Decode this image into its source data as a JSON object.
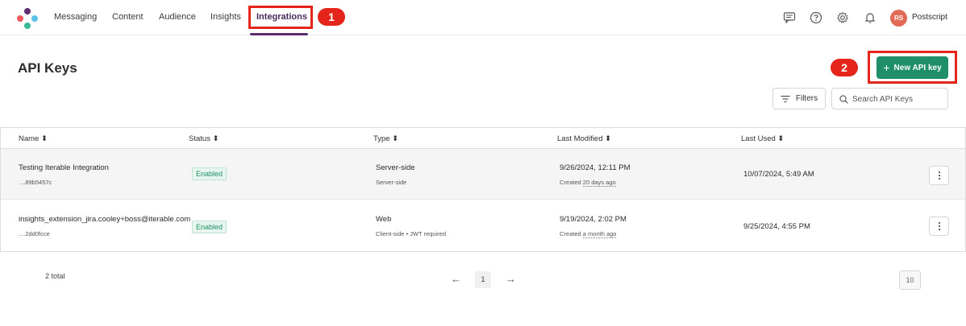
{
  "nav": {
    "items": [
      "Messaging",
      "Content",
      "Audience",
      "Insights",
      "Integrations"
    ],
    "active": "Integrations"
  },
  "account": {
    "initials": "RS",
    "name": "Postscript"
  },
  "annotations": {
    "badge1": "1",
    "badge2": "2",
    "color": "#e5241b"
  },
  "page": {
    "title": "API Keys",
    "new_button": "New API key",
    "filters_label": "Filters",
    "search_placeholder": "Search API Keys"
  },
  "table": {
    "headers": [
      "Name",
      "Status",
      "Type",
      "Last Modified",
      "Last Used"
    ],
    "rows": [
      {
        "name": "Testing Iterable Integration",
        "key": "....89b5457c",
        "status": "Enabled",
        "type": "Server-side",
        "type_detail": "Server-side",
        "modified": "9/26/2024, 12:11 PM",
        "created_prefix": "Created",
        "created_ago": "20 days ago",
        "last_used": "10/07/2024, 5:49 AM"
      },
      {
        "name": "insights_extension_jira.cooley+boss@iterable.com",
        "key": "....2dd0fcce",
        "status": "Enabled",
        "type": "Web",
        "type_detail": "Client-side • JWT required",
        "modified": "9/19/2024, 2:02 PM",
        "created_prefix": "Created",
        "created_ago": "a month ago",
        "last_used": "9/25/2024, 4:55 PM"
      }
    ]
  },
  "pagination": {
    "total": "2 total",
    "current_page": "1",
    "page_size": "10"
  },
  "colors": {
    "accent": "#1f8f6a",
    "nav_active": "#5e2d6f",
    "avatar": "#e06a56"
  }
}
